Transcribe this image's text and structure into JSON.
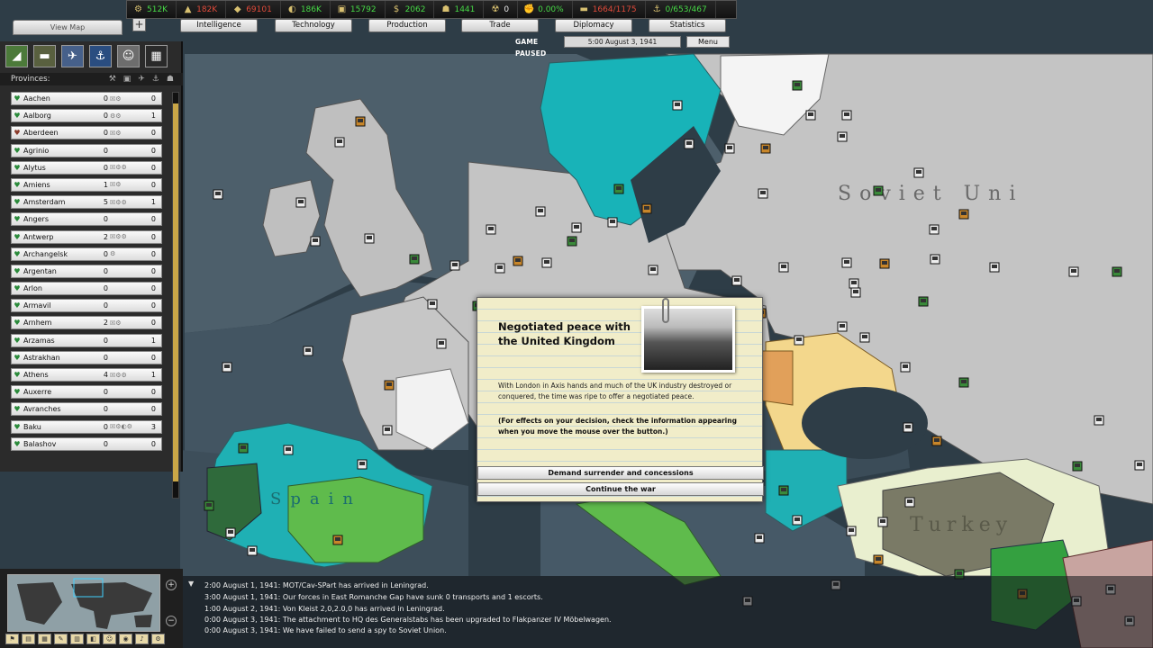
{
  "topbar": {
    "resources": [
      {
        "icon": "energy-icon",
        "glyph": "⚙",
        "value": "512K",
        "color": "green"
      },
      {
        "icon": "metal-icon",
        "glyph": "▲",
        "value": "182K",
        "color": "red"
      },
      {
        "icon": "rare-materials-icon",
        "glyph": "◆",
        "value": "69101",
        "color": "red"
      },
      {
        "icon": "oil-icon",
        "glyph": "◐",
        "value": "186K",
        "color": "green"
      },
      {
        "icon": "supplies-icon",
        "glyph": "▣",
        "value": "15792",
        "color": "green"
      },
      {
        "icon": "money-icon",
        "glyph": "$",
        "value": "2062",
        "color": "green"
      },
      {
        "icon": "manpower-icon",
        "glyph": "☗",
        "value": "1441",
        "color": "green"
      },
      {
        "icon": "nuclear-icon",
        "glyph": "☢",
        "value": "0",
        "color": "white"
      },
      {
        "icon": "dissent-icon",
        "glyph": "✊",
        "value": "0.00%",
        "color": "green"
      },
      {
        "icon": "transport-icon",
        "glyph": "▬",
        "value": "1664/1175",
        "color": "red"
      },
      {
        "icon": "convoy-icon",
        "glyph": "⚓",
        "value": "0/653/467",
        "color": "green"
      }
    ],
    "view_map_label": "View Map",
    "tabs": [
      "Intelligence",
      "Technology",
      "Production",
      "Trade",
      "Diplomacy",
      "Statistics"
    ],
    "status": "GAME PAUSED",
    "date": "5:00 August 3, 1941",
    "menu_label": "Menu"
  },
  "left_panel": {
    "header": "Provinces:",
    "provinces": [
      {
        "name": "Aachen",
        "count": "0",
        "sym": "☒⚙",
        "right": "0"
      },
      {
        "name": "Aalborg",
        "count": "0",
        "sym": "⚙⚙",
        "right": "1"
      },
      {
        "name": "Aberdeen",
        "count": "0",
        "sym": "☒⚙",
        "right": "0"
      },
      {
        "name": "Agrinio",
        "count": "0",
        "sym": "",
        "right": "0"
      },
      {
        "name": "Alytus",
        "count": "0",
        "sym": "☒⚙⚙",
        "right": "0"
      },
      {
        "name": "Amiens",
        "count": "1",
        "sym": "☒⚙",
        "right": "0"
      },
      {
        "name": "Amsterdam",
        "count": "5",
        "sym": "☒⚙⚙",
        "right": "1"
      },
      {
        "name": "Angers",
        "count": "0",
        "sym": "",
        "right": "0"
      },
      {
        "name": "Antwerp",
        "count": "2",
        "sym": "☒⚙⚙",
        "right": "0"
      },
      {
        "name": "Archangelsk",
        "count": "0",
        "sym": "⚙",
        "right": "0"
      },
      {
        "name": "Argentan",
        "count": "0",
        "sym": "",
        "right": "0"
      },
      {
        "name": "Arlon",
        "count": "0",
        "sym": "",
        "right": "0"
      },
      {
        "name": "Armavil",
        "count": "0",
        "sym": "",
        "right": "0"
      },
      {
        "name": "Arnhem",
        "count": "2",
        "sym": "☒⚙",
        "right": "0"
      },
      {
        "name": "Arzamas",
        "count": "0",
        "sym": "",
        "right": "1"
      },
      {
        "name": "Astrakhan",
        "count": "0",
        "sym": "",
        "right": "0"
      },
      {
        "name": "Athens",
        "count": "4",
        "sym": "☒⚙⚙",
        "right": "1"
      },
      {
        "name": "Auxerre",
        "count": "0",
        "sym": "",
        "right": "0"
      },
      {
        "name": "Avranches",
        "count": "0",
        "sym": "",
        "right": "0"
      },
      {
        "name": "Baku",
        "count": "0",
        "sym": "☒⚙◐⚙",
        "right": "3"
      },
      {
        "name": "Balashov",
        "count": "0",
        "sym": "",
        "right": "0"
      }
    ]
  },
  "event": {
    "title": "Negotiated peace with the United Kingdom",
    "body": "With London in Axis hands and much of the UK industry destroyed or conquered, the time was ripe to offer a negotiated peace.",
    "note": "(For effects on your decision, check the information appearing when you move the mouse over the button.)",
    "option_a": "Demand surrender and concessions",
    "option_b": "Continue the war"
  },
  "log": [
    "2:00 August 1, 1941: MOT/Cav-SPart has arrived in Leningrad.",
    "3:00 August 1, 1941: Our forces in East Romanche Gap have sunk 0 transports and 1 escorts.",
    "1:00 August 2, 1941: Von Kleist 2,0,2.0,0 has arrived in Leningrad.",
    "0:00 August 3, 1941: The attachment to HQ des Generalstabs has been upgraded to Flakpanzer IV Möbelwagen.",
    "0:00 August 3, 1941: We have failed to send a spy to Soviet Union."
  ],
  "map_labels": {
    "soviet": "Soviet Uni",
    "turkey": "Turkey",
    "spain": "Spain"
  },
  "colors": {
    "sea": "#4a5c68",
    "deep_sea": "#2e3d47",
    "axis_land": "#c8c8c8",
    "sweden": "#17b3b8",
    "italy": "#5cb94a",
    "turkey_light": "#eaf0d0",
    "romania": "#f2d58a",
    "dialog_paper": "#f1edc9"
  }
}
